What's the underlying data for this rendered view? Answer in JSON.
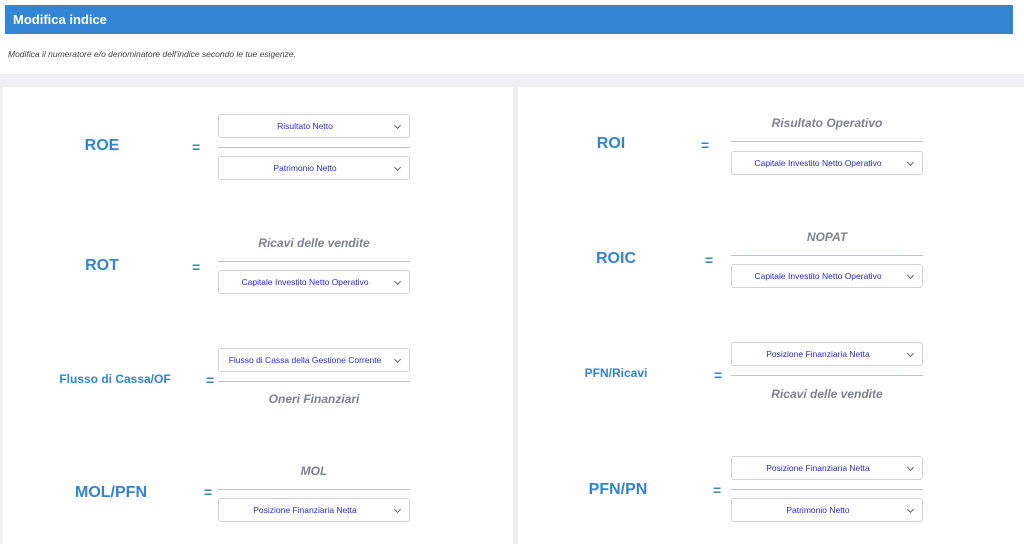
{
  "header": {
    "title": "Modifica indice",
    "subtitle": "Modifica il numeratore e/o denominatore dell'indice secondo le tue esigenze."
  },
  "equals": "=",
  "left": [
    {
      "name": "ROE",
      "num": "Risultato Netto",
      "den": "Patrimonio Netto"
    },
    {
      "name": "ROT",
      "num_fixed": "Ricavi delle vendite",
      "den": "Capitale Investito Netto Operativo"
    },
    {
      "name": "Flusso di Cassa/OF",
      "num": "Flusso di Cassa della Gestione Corrente",
      "den_fixed": "Oneri Finanziari"
    },
    {
      "name": "MOL/PFN",
      "num_fixed": "MOL",
      "den": "Posizione Finanziaria Netta"
    }
  ],
  "right": [
    {
      "name": "ROI",
      "num_fixed": "Risultato Operativo",
      "den": "Capitale Investito Netto Operativo"
    },
    {
      "name": "ROIC",
      "num_fixed": "NOPAT",
      "den": "Capitale Investito Netto Operativo"
    },
    {
      "name": "PFN/Ricavi",
      "num": "Posizione Finanziaria Netta",
      "den_fixed": "Ricavi delle vendite"
    },
    {
      "name": "PFN/PN",
      "num": "Posizione Finanziaria Netta",
      "den": "Patrimonio Netto"
    }
  ]
}
